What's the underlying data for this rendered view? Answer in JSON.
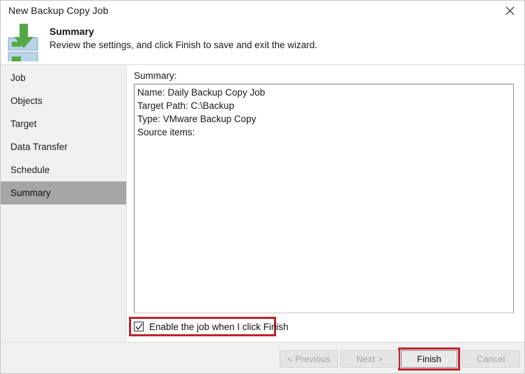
{
  "window": {
    "title": "New Backup Copy Job",
    "close_icon": "close-icon"
  },
  "header": {
    "icon": "backup-copy-download-icon",
    "title": "Summary",
    "subtitle": "Review the settings, and click Finish to save and exit the wizard."
  },
  "sidebar": {
    "items": [
      {
        "label": "Job",
        "selected": false
      },
      {
        "label": "Objects",
        "selected": false
      },
      {
        "label": "Target",
        "selected": false
      },
      {
        "label": "Data Transfer",
        "selected": false
      },
      {
        "label": "Schedule",
        "selected": false
      },
      {
        "label": "Summary",
        "selected": true
      }
    ]
  },
  "content": {
    "summary_label": "Summary:",
    "summary_lines": [
      "Name: Daily Backup Copy Job",
      "Target Path: C:\\Backup",
      "Type: VMware Backup Copy",
      "Source items:"
    ],
    "enable_checkbox": {
      "label": "Enable the job when I click Finish",
      "checked": true,
      "highlighted": true
    }
  },
  "footer": {
    "buttons": [
      {
        "label": "< Previous",
        "enabled": false,
        "highlighted": false
      },
      {
        "label": "Next >",
        "enabled": false,
        "highlighted": false
      },
      {
        "label": "Finish",
        "enabled": true,
        "highlighted": true
      },
      {
        "label": "Cancel",
        "enabled": false,
        "highlighted": false
      }
    ]
  },
  "colors": {
    "highlight_red": "#c0232a",
    "sidebar_bg": "#f0f0f0",
    "selected_item_bg": "#a6a6a6",
    "icon_green": "#56a843",
    "icon_blue": "#b8d4e8"
  }
}
